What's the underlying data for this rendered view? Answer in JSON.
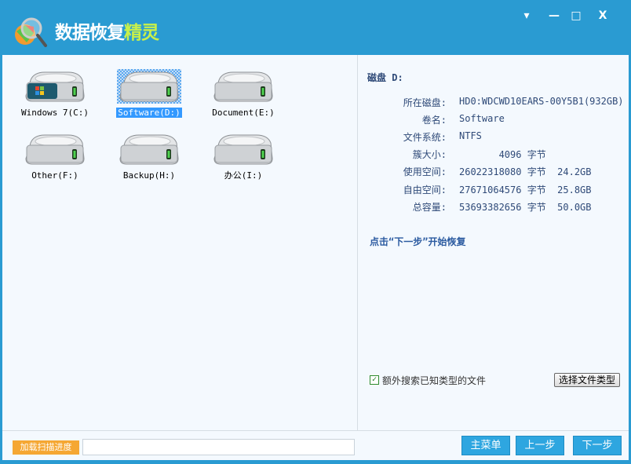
{
  "app": {
    "title_main": "数据恢复",
    "title_accent": "精灵"
  },
  "window_controls": {
    "menu": "▾",
    "minimize": "—",
    "maximize": "□",
    "close": "X"
  },
  "drives": [
    {
      "label": "Windows 7(C:)",
      "selected": false,
      "system": true
    },
    {
      "label": "Software(D:)",
      "selected": true
    },
    {
      "label": "Document(E:)",
      "selected": false
    },
    {
      "label": "Other(F:)",
      "selected": false
    },
    {
      "label": "Backup(H:)",
      "selected": false
    },
    {
      "label": "办公(I:)",
      "selected": false
    }
  ],
  "details": {
    "header": "磁盘 D:",
    "rows": [
      {
        "key": "所在磁盘:",
        "value": "HD0:WDCWD10EARS-00Y5B1(932GB)"
      },
      {
        "key": "卷名:",
        "value": "Software"
      },
      {
        "key": "文件系统:",
        "value": "NTFS"
      },
      {
        "key": "簇大小:",
        "value": "       4096 字节"
      },
      {
        "key": "使用空间:",
        "value": "26022318080 字节  24.2GB"
      },
      {
        "key": "自由空间:",
        "value": "27671064576 字节  25.8GB"
      },
      {
        "key": "总容量:",
        "value": "53693382656 字节  50.0GB"
      }
    ],
    "hint": "点击“下一步”开始恢复"
  },
  "options": {
    "extra_search_label": "额外搜索已知类型的文件",
    "extra_search_checked": true,
    "select_types_button": "选择文件类型"
  },
  "footer": {
    "load_progress_button": "加载扫描进度",
    "main_menu": "主菜单",
    "prev": "上一步",
    "next": "下一步"
  },
  "colors": {
    "titlebar": "#2a9bd2",
    "accent": "#c8f04a",
    "orange": "#f5a733",
    "button": "#2ea6e0"
  }
}
